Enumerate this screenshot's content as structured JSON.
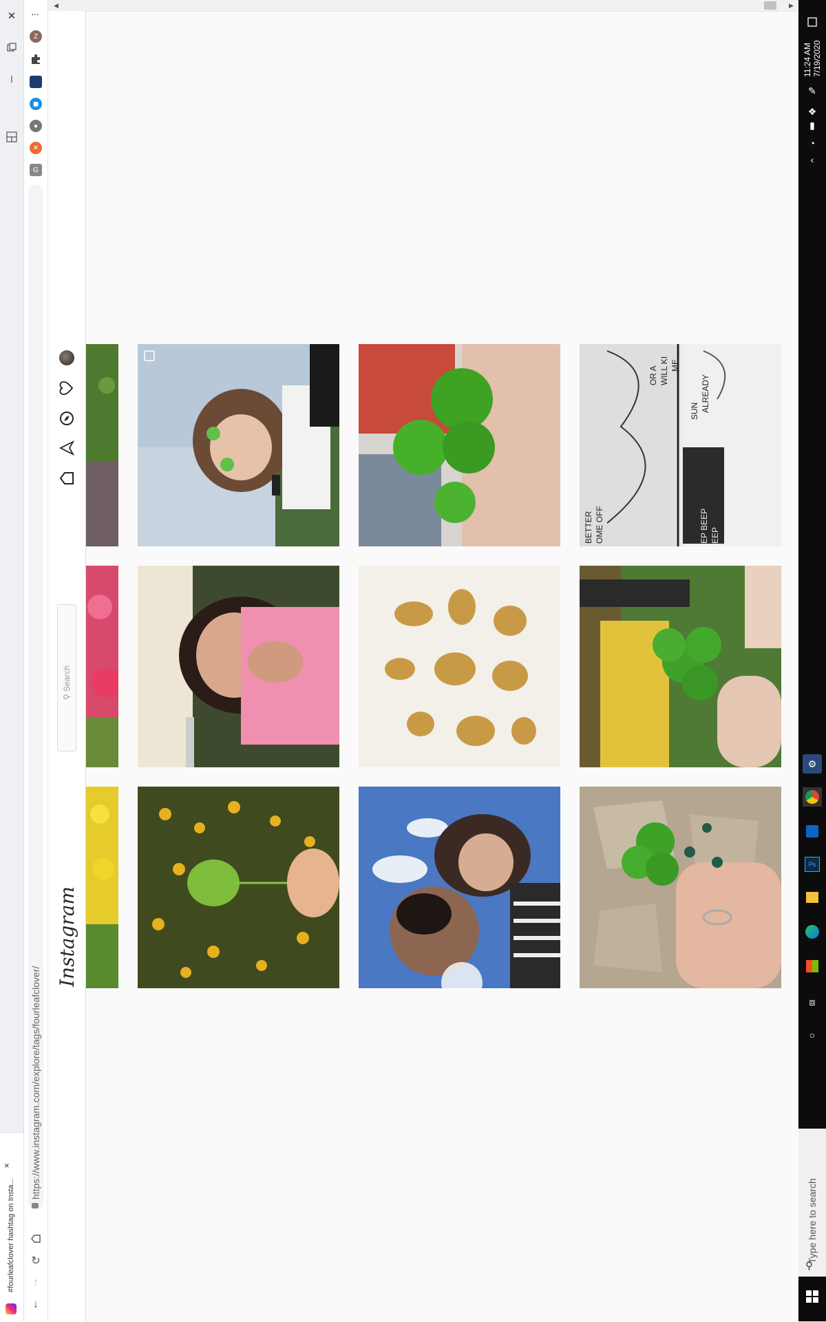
{
  "browser": {
    "tab_title": "#fourleafclover hashtag on Insta...",
    "url_host": "https://www.instagram.com",
    "url_path": "/explore/tags/fourleafclover/",
    "tab_close_symbol": "×",
    "new_tab_symbol": "+",
    "extension_z_label": "Z"
  },
  "instagram": {
    "logo": "Instagram",
    "search_placeholder": "Search",
    "nav_icons": [
      "home-icon",
      "direct-icon",
      "explore-icon",
      "activity-icon",
      "profile-avatar"
    ]
  },
  "grid": {
    "posts": [
      {
        "subject": "sunflowers with clover"
      },
      {
        "subject": "selfie couple"
      },
      {
        "subject": "hand holding clover on gravel"
      },
      {
        "subject": "girl in pink dress"
      },
      {
        "subject": "gold charms"
      },
      {
        "subject": "fingers holding clover"
      },
      {
        "subject": "girl heart hands"
      },
      {
        "subject": "hand with clover"
      },
      {
        "subject": "comic drawing"
      }
    ],
    "comic_text": [
      "BETTER",
      "OME OFF",
      "OR A",
      "WILL KI",
      "ME",
      "SUN",
      "ALREADY",
      "EP BEEP",
      "EEP"
    ]
  },
  "taskbar": {
    "search_placeholder": "Type here to search",
    "time": "11:24 AM",
    "date": "7/19/2020"
  },
  "colors": {
    "taskbar_bg": "#0c0c0c",
    "page_bg": "#fafafa"
  }
}
